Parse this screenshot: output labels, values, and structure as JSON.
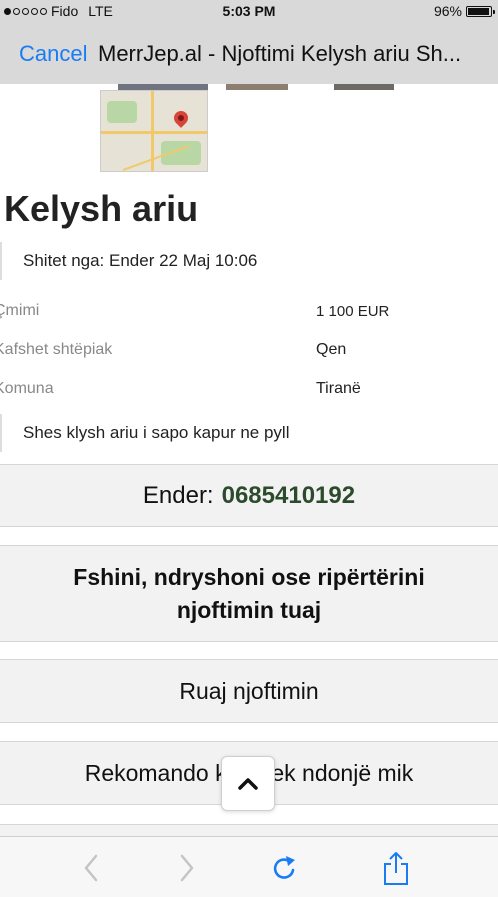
{
  "status_bar": {
    "carrier": "Fido",
    "network": "LTE",
    "time": "5:03 PM",
    "battery": "96%",
    "battery_level": 0.96
  },
  "nav": {
    "cancel_label": "Cancel",
    "title": "MerrJep.al - Njoftimi Kelysh ariu Sh..."
  },
  "ad": {
    "title": "Kelysh ariu",
    "seller_line": "Shitet nga: Ender 22 Maj 10:06",
    "details": [
      {
        "label": "Çmimi",
        "value": "1 100 EUR"
      },
      {
        "label": "Kafshet shtëpiak",
        "value": "Qen"
      },
      {
        "label": "Komuna",
        "value": "Tiranë"
      }
    ],
    "description": "Shes klysh ariu i sapo kapur ne pyll"
  },
  "actions": {
    "contact_name": "Ender:",
    "contact_phone": "0685410192",
    "edit_line1": "Fshini, ndryshoni ose ripërtërini",
    "edit_line2": "njoftimin tuaj",
    "save_label": "Ruaj njoftimin",
    "recommend_label": "Rekomando këtë tek ndonjë mik"
  },
  "colors": {
    "link_blue": "#1a7cf5",
    "phone_green": "#2c4a2c",
    "bar_gray": "#d9d9d9"
  },
  "icons": {
    "back": "chevron-left-icon",
    "forward": "chevron-right-icon",
    "reload": "reload-icon",
    "share": "share-icon",
    "scroll_top": "chevron-up-icon"
  }
}
